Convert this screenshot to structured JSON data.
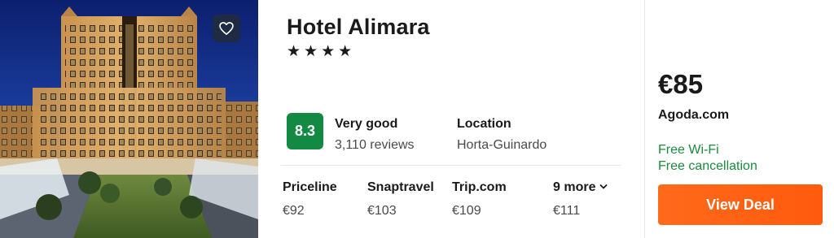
{
  "hotel": {
    "name": "Hotel Alimara",
    "stars": [
      "★",
      "★",
      "★",
      "★"
    ]
  },
  "rating": {
    "score": "8.3",
    "label": "Very good",
    "reviews": "3,110 reviews"
  },
  "location": {
    "label": "Location",
    "value": "Horta-Guinardo"
  },
  "providers": [
    {
      "name": "Priceline",
      "price": "€92"
    },
    {
      "name": "Snaptravel",
      "price": "€103"
    },
    {
      "name": "Trip.com",
      "price": "€109"
    },
    {
      "name": "9 more",
      "price": "€111"
    }
  ],
  "deal": {
    "price": "€85",
    "provider": "Agoda.com",
    "features": [
      "Free Wi-Fi",
      "Free cancellation"
    ],
    "button_label": "View Deal"
  },
  "colors": {
    "score_badge": "#128a44",
    "feature_text": "#1a8a3c",
    "deal_button": "#ff5a0d",
    "favorite_button": "#1f2a44"
  },
  "icons": {
    "favorite": "heart-outline-icon",
    "more": "chevron-down-icon",
    "star": "star-icon"
  }
}
